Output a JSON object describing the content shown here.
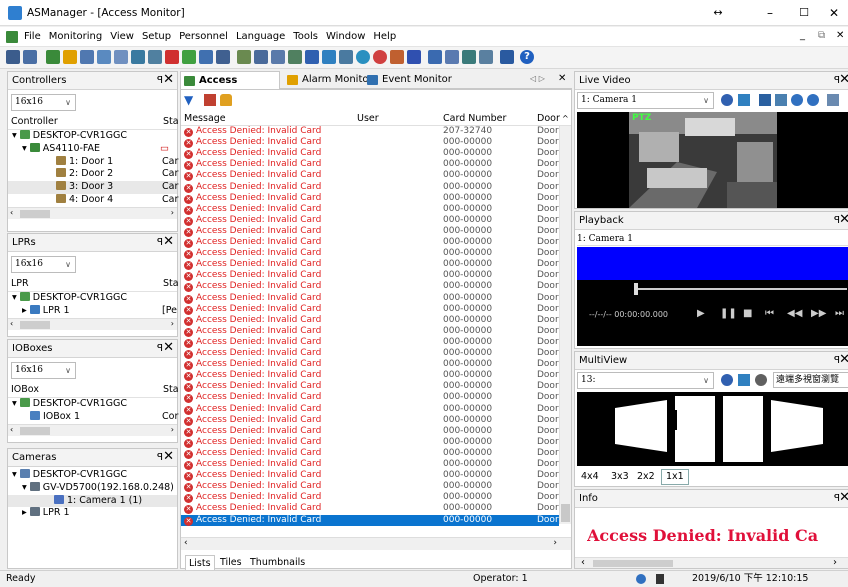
{
  "window": {
    "title": "ASManager - [Access Monitor]"
  },
  "menu": [
    "File",
    "Monitoring",
    "View",
    "Setup",
    "Personnel",
    "Language",
    "Tools",
    "Window",
    "Help"
  ],
  "controllers": {
    "title": "Controllers",
    "layout": "16x16",
    "col1": "Controller",
    "col2": "Sta",
    "items": [
      {
        "label": "DESKTOP-CVR1GGC",
        "status": ""
      },
      {
        "label": "AS4110-FAE",
        "status": ""
      },
      {
        "label": "1: Door 1",
        "status": "Car"
      },
      {
        "label": "2: Door 2",
        "status": "Car"
      },
      {
        "label": "3: Door 3",
        "status": "Car"
      },
      {
        "label": "4: Door 4",
        "status": "Car"
      }
    ]
  },
  "lprs": {
    "title": "LPRs",
    "layout": "16x16",
    "col1": "LPR",
    "col2": "Sta",
    "items": [
      {
        "label": "DESKTOP-CVR1GGC",
        "status": ""
      },
      {
        "label": "LPR 1",
        "status": "[Pe"
      }
    ]
  },
  "ioboxes": {
    "title": "IOBoxes",
    "layout": "16x16",
    "col1": "IOBox",
    "col2": "Sta",
    "items": [
      {
        "label": "DESKTOP-CVR1GGC",
        "status": ""
      },
      {
        "label": "IOBox 1",
        "status": "Cor"
      }
    ]
  },
  "cameras": {
    "title": "Cameras",
    "items": [
      {
        "label": "DESKTOP-CVR1GGC"
      },
      {
        "label": "GV-VD5700(192.168.0.248)"
      },
      {
        "label": "1: Camera 1 (1)"
      },
      {
        "label": "LPR 1"
      }
    ]
  },
  "tabs": [
    {
      "label": "Access Monitor"
    },
    {
      "label": "Alarm Monitor"
    },
    {
      "label": "Event Monitor"
    }
  ],
  "grid": {
    "headers": {
      "message": "Message",
      "user": "User",
      "card": "Card Number",
      "door": "Door"
    },
    "rows": [
      {
        "message": "Access Denied: Invalid Card",
        "card": "207-32740",
        "door": "Door"
      },
      {
        "message": "Access Denied: Invalid Card",
        "card": "000-00000",
        "door": "Door"
      },
      {
        "message": "Access Denied: Invalid Card",
        "card": "000-00000",
        "door": "Door"
      },
      {
        "message": "Access Denied: Invalid Card",
        "card": "000-00000",
        "door": "Door"
      },
      {
        "message": "Access Denied: Invalid Card",
        "card": "000-00000",
        "door": "Door"
      },
      {
        "message": "Access Denied: Invalid Card",
        "card": "000-00000",
        "door": "Door"
      },
      {
        "message": "Access Denied: Invalid Card",
        "card": "000-00000",
        "door": "Door"
      },
      {
        "message": "Access Denied: Invalid Card",
        "card": "000-00000",
        "door": "Door"
      },
      {
        "message": "Access Denied: Invalid Card",
        "card": "000-00000",
        "door": "Door"
      },
      {
        "message": "Access Denied: Invalid Card",
        "card": "000-00000",
        "door": "Door"
      },
      {
        "message": "Access Denied: Invalid Card",
        "card": "000-00000",
        "door": "Door"
      },
      {
        "message": "Access Denied: Invalid Card",
        "card": "000-00000",
        "door": "Door"
      },
      {
        "message": "Access Denied: Invalid Card",
        "card": "000-00000",
        "door": "Door"
      },
      {
        "message": "Access Denied: Invalid Card",
        "card": "000-00000",
        "door": "Door"
      },
      {
        "message": "Access Denied: Invalid Card",
        "card": "000-00000",
        "door": "Door"
      },
      {
        "message": "Access Denied: Invalid Card",
        "card": "000-00000",
        "door": "Door"
      },
      {
        "message": "Access Denied: Invalid Card",
        "card": "000-00000",
        "door": "Door"
      },
      {
        "message": "Access Denied: Invalid Card",
        "card": "000-00000",
        "door": "Door"
      },
      {
        "message": "Access Denied: Invalid Card",
        "card": "000-00000",
        "door": "Door"
      },
      {
        "message": "Access Denied: Invalid Card",
        "card": "000-00000",
        "door": "Door"
      },
      {
        "message": "Access Denied: Invalid Card",
        "card": "000-00000",
        "door": "Door"
      },
      {
        "message": "Access Denied: Invalid Card",
        "card": "000-00000",
        "door": "Door"
      },
      {
        "message": "Access Denied: Invalid Card",
        "card": "000-00000",
        "door": "Door"
      },
      {
        "message": "Access Denied: Invalid Card",
        "card": "000-00000",
        "door": "Door"
      },
      {
        "message": "Access Denied: Invalid Card",
        "card": "000-00000",
        "door": "Door"
      },
      {
        "message": "Access Denied: Invalid Card",
        "card": "000-00000",
        "door": "Door"
      },
      {
        "message": "Access Denied: Invalid Card",
        "card": "000-00000",
        "door": "Door"
      },
      {
        "message": "Access Denied: Invalid Card",
        "card": "000-00000",
        "door": "Door"
      },
      {
        "message": "Access Denied: Invalid Card",
        "card": "000-00000",
        "door": "Door"
      },
      {
        "message": "Access Denied: Invalid Card",
        "card": "000-00000",
        "door": "Door"
      },
      {
        "message": "Access Denied: Invalid Card",
        "card": "000-00000",
        "door": "Door"
      },
      {
        "message": "Access Denied: Invalid Card",
        "card": "000-00000",
        "door": "Door"
      },
      {
        "message": "Access Denied: Invalid Card",
        "card": "000-00000",
        "door": "Door"
      },
      {
        "message": "Access Denied: Invalid Card",
        "card": "000-00000",
        "door": "Door"
      },
      {
        "message": "Access Denied: Invalid Card",
        "card": "000-00000",
        "door": "Door"
      },
      {
        "message": "Access Denied: Invalid Card",
        "card": "000-00000",
        "door": "Door"
      }
    ]
  },
  "bottom_tabs": [
    "Lists",
    "Tiles",
    "Thumbnails"
  ],
  "live_video": {
    "title": "Live Video",
    "camera": "1: Camera 1",
    "overlay": "PTZ"
  },
  "playback": {
    "title": "Playback",
    "camera": "1: Camera 1",
    "time": "--/--/-- 00:00:00.000"
  },
  "multiview": {
    "title": "MultiView",
    "channel": "13:",
    "remote": "遠端多視窗瀏覽",
    "layouts": [
      "4x4",
      "3x3",
      "2x2",
      "1x1"
    ]
  },
  "info": {
    "title": "Info",
    "message": "Access Denied: Invalid Ca"
  },
  "status": {
    "ready": "Ready",
    "operator": "Operator: 1",
    "datetime": "2019/6/10 下午 12:10:15"
  },
  "colors": {
    "selection": "#0a74cf",
    "denied": "#e02020",
    "info_text": "#e0103a",
    "playback_bar": "#0000ff"
  }
}
